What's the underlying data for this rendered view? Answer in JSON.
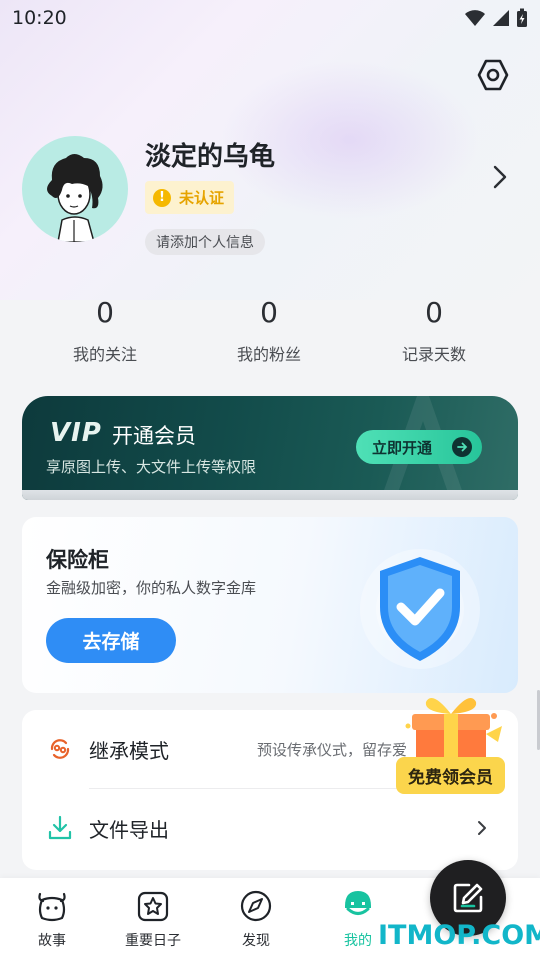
{
  "status_bar": {
    "time": "10:20"
  },
  "profile": {
    "username": "淡定的乌龟",
    "verify_badge": "未认证",
    "info_pill": "请添加个人信息"
  },
  "stats": [
    {
      "value": "0",
      "label": "我的关注"
    },
    {
      "value": "0",
      "label": "我的粉丝"
    },
    {
      "value": "0",
      "label": "记录天数"
    }
  ],
  "vip": {
    "logo": "VIP",
    "title": "开通会员",
    "subtitle": "享原图上传、大文件上传等权限",
    "button": "立即开通"
  },
  "vault": {
    "title": "保险柜",
    "subtitle": "金融级加密，你的私人数字金库",
    "button": "去存储"
  },
  "menu": {
    "items": [
      {
        "label": "继承模式",
        "desc": "预设传承仪式，留存爱"
      },
      {
        "label": "文件导出",
        "desc": ""
      }
    ]
  },
  "promo": {
    "label": "免费领会员"
  },
  "tabbar": {
    "tabs": [
      {
        "label": "故事"
      },
      {
        "label": "重要日子"
      },
      {
        "label": "发现"
      },
      {
        "label": "我的"
      }
    ]
  },
  "watermark": "ITMOP.COM",
  "colors": {
    "accent_green": "#18c3a0",
    "vip_bg": "#124b4a",
    "vault_button": "#2f8df5",
    "promo_yellow": "#fbd54c",
    "verify_orange": "#e6a400"
  }
}
